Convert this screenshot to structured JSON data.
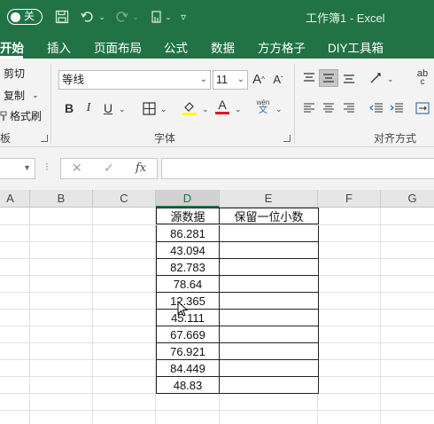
{
  "titlebar": {
    "autosave_label": "关",
    "title": "工作簿1  -  Excel"
  },
  "tabs": [
    {
      "label": "开始",
      "active": true
    },
    {
      "label": "插入"
    },
    {
      "label": "页面布局"
    },
    {
      "label": "公式"
    },
    {
      "label": "数据"
    },
    {
      "label": "方方格子"
    },
    {
      "label": "DIY工具箱"
    }
  ],
  "ribbon": {
    "clipboard": {
      "cut": "剪切",
      "copy": "复制",
      "format_painter": "格式刷",
      "group_label": "板"
    },
    "font": {
      "font_name": "等线",
      "font_size": "11",
      "bold": "B",
      "italic": "I",
      "underline": "U",
      "grow": "A",
      "shrink": "A",
      "font_color_letter": "A",
      "wen_top": "wén",
      "wen_bottom": "文",
      "group_label": "字体"
    },
    "alignment": {
      "group_label": "对齐方式",
      "wrap_label": "ab",
      "wrap_sub": "c"
    }
  },
  "formulabar": {
    "fx_label": "fx",
    "cancel": "✕",
    "enter": "✓"
  },
  "grid": {
    "column_headers": [
      "A",
      "B",
      "C",
      "D",
      "E",
      "F",
      "G"
    ],
    "selected_column": "D",
    "header_row": {
      "d": "源数据",
      "e": "保留一位小数"
    },
    "values": [
      "86.281",
      "43.094",
      "82.783",
      "78.64",
      "12.365",
      "45.111",
      "67.669",
      "76.921",
      "84.449",
      "48.83"
    ]
  },
  "colors": {
    "excel_green": "#217346",
    "font_color_bar": "#e81123",
    "highlight_bar": "#ffff00"
  }
}
